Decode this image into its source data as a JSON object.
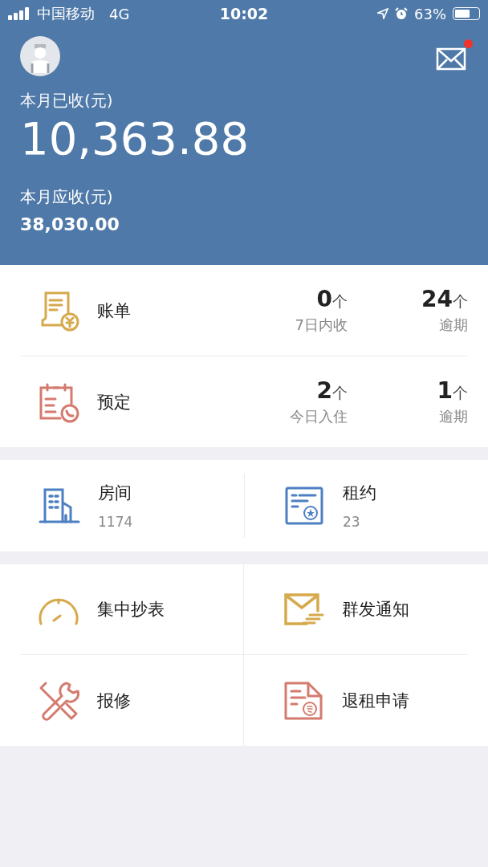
{
  "status_bar": {
    "carrier": "中国移动",
    "network": "4G",
    "time": "10:02",
    "battery": "63%"
  },
  "header": {
    "unread": true,
    "received_label": "本月已收(元)",
    "received_amount": "10,363.88",
    "due_label": "本月应收(元)",
    "due_amount": "38,030.00"
  },
  "summary": [
    {
      "kind": "bill",
      "title": "账单",
      "stats": [
        {
          "value": "0",
          "unit": "个",
          "label": "7日内收"
        },
        {
          "value": "24",
          "unit": "个",
          "label": "逾期"
        }
      ]
    },
    {
      "kind": "booking",
      "title": "预定",
      "stats": [
        {
          "value": "2",
          "unit": "个",
          "label": "今日入住"
        },
        {
          "value": "1",
          "unit": "个",
          "label": "逾期"
        }
      ]
    }
  ],
  "tiles": [
    {
      "kind": "rooms",
      "title": "房间",
      "count": "1174"
    },
    {
      "kind": "leases",
      "title": "租约",
      "count": "23"
    }
  ],
  "actions": [
    {
      "kind": "meter",
      "title": "集中抄表"
    },
    {
      "kind": "notice",
      "title": "群发通知"
    },
    {
      "kind": "repair",
      "title": "报修"
    },
    {
      "kind": "checkout",
      "title": "退租申请"
    }
  ]
}
